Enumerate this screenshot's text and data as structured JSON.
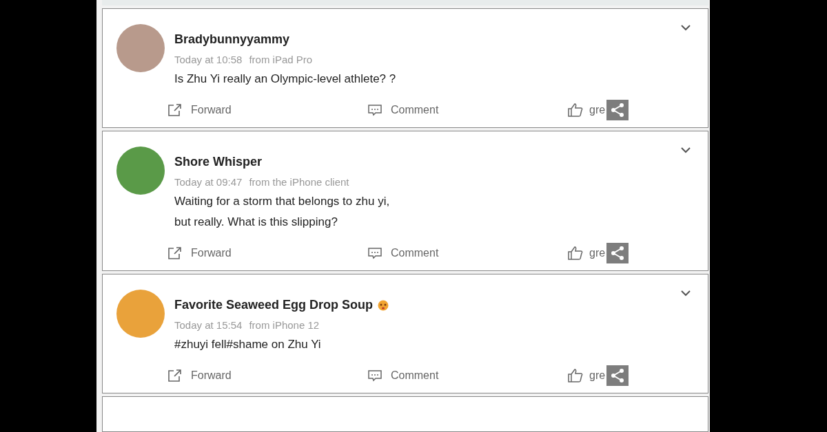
{
  "posts": [
    {
      "author": "Bradybunnyyammy",
      "time": "Today at 10:58",
      "source": "from iPad Pro",
      "lines": [
        "Is Zhu Yi really an Olympic-level athlete? ?"
      ],
      "emoji": false,
      "actions": {
        "forward": "Forward",
        "comment": "Comment",
        "like": "gre"
      }
    },
    {
      "author": "Shore Whisper",
      "time": "Today at 09:47",
      "source": "from the iPhone client",
      "lines": [
        "Waiting for a storm that belongs to zhu yi,",
        "but really. What is this slipping?"
      ],
      "emoji": false,
      "actions": {
        "forward": "Forward",
        "comment": "Comment",
        "like": "gre"
      }
    },
    {
      "author": "Favorite Seaweed Egg Drop Soup",
      "time": "Today at 15:54",
      "source": "from iPhone 12",
      "lines": [
        "#zhuyi fell#shame on Zhu Yi"
      ],
      "emoji": true,
      "actions": {
        "forward": "Forward",
        "comment": "Comment",
        "like": "gre"
      }
    }
  ]
}
